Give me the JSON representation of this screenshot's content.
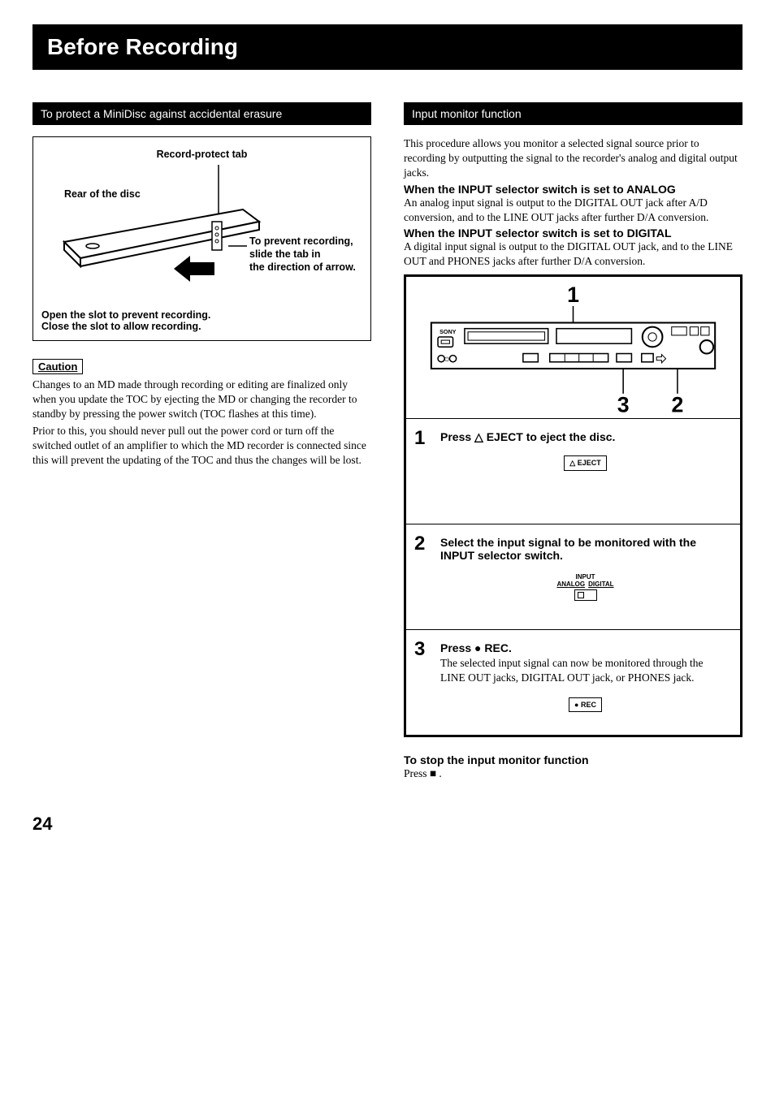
{
  "page": {
    "title": "Before Recording",
    "number": "24"
  },
  "left": {
    "header": "To protect a MiniDisc against accidental erasure",
    "diagram": {
      "tab_label": "Record-protect tab",
      "rear_label": "Rear of the disc",
      "prevent_line1": "To prevent recording,",
      "prevent_line2": "slide the tab in",
      "prevent_line3": "the direction of arrow.",
      "open_line": "Open the slot to prevent recording.",
      "close_line": "Close the slot to allow recording."
    },
    "caution_label": "Caution",
    "caution_p1": "Changes to an MD made through recording or editing are finalized only when you update the TOC by ejecting the MD or changing the recorder to standby by pressing the power switch (TOC flashes at this time).",
    "caution_p2": "Prior to this, you should never pull out the power cord or turn off the switched outlet of an amplifier to which the MD recorder is connected since this will prevent the updating of the TOC and thus the changes will be lost."
  },
  "right": {
    "header": "Input monitor function",
    "intro": "This procedure allows you monitor a selected signal source prior to recording by outputting the signal to the recorder's analog and digital output jacks.",
    "analog_hdr": "When the INPUT selector switch is set to ANALOG",
    "analog_body": "An analog input signal is output to the DIGITAL OUT jack after A/D conversion, and to the LINE OUT jacks after further D/A conversion.",
    "digital_hdr": "When the INPUT selector switch is set to DIGITAL",
    "digital_body": "A digital input signal is output to the DIGITAL OUT jack, and to the LINE OUT and PHONES jacks after further D/A conversion.",
    "steps_header": {
      "label_1": "1",
      "label_2": "2",
      "label_3": "3",
      "brand": "SONY"
    },
    "steps": [
      {
        "num": "1",
        "title": "Press △ EJECT to eject the disc.",
        "desc": "",
        "button": "△ EJECT"
      },
      {
        "num": "2",
        "title": "Select the input signal to be monitored with the INPUT selector switch.",
        "desc": "",
        "switch_top": "INPUT",
        "switch_left": "ANALOG",
        "switch_right": "DIGITAL"
      },
      {
        "num": "3",
        "title": "Press ● REC.",
        "desc": "The selected input signal can now be monitored through the LINE OUT jacks, DIGITAL OUT jack, or PHONES jack.",
        "button": "● REC"
      }
    ],
    "stop_hdr": "To stop the input monitor function",
    "stop_body": "Press ■ ."
  }
}
